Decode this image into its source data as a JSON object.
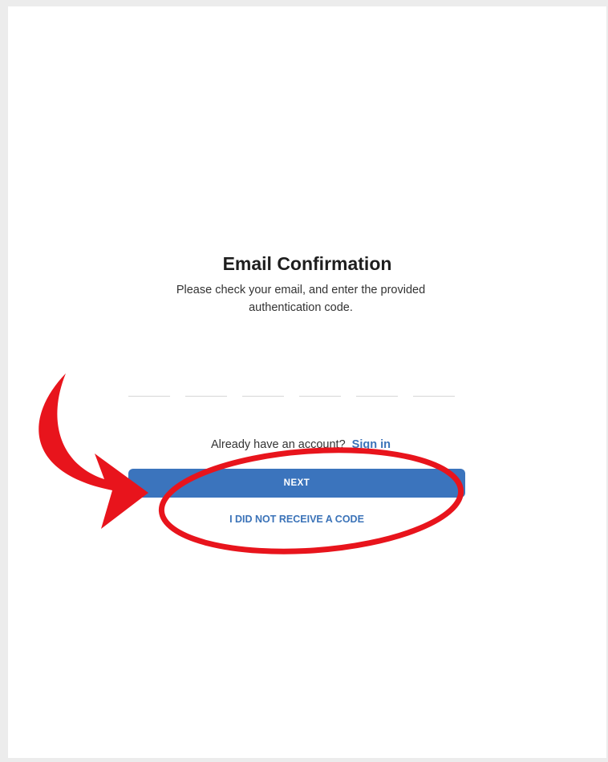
{
  "confirmation": {
    "title": "Email Confirmation",
    "instructions": "Please check your email, and enter the provided authentication code.",
    "code_digits": [
      "",
      "",
      "",
      "",
      "",
      ""
    ]
  },
  "signin": {
    "prompt": "Already have an account?",
    "link_label": "Sign in"
  },
  "actions": {
    "next_label": "NEXT",
    "no_code_label": "I DID NOT RECEIVE A CODE"
  },
  "annotation": {
    "color": "#e8141c",
    "shapes": [
      "curved-arrow",
      "ellipse-highlight"
    ]
  }
}
